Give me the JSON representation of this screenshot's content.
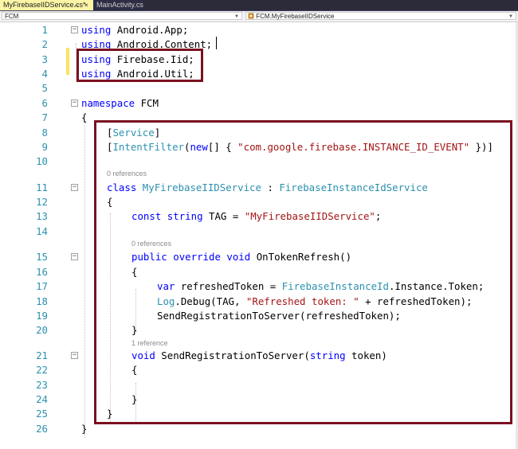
{
  "tabs": [
    {
      "label": "MyFirebaseIIDService.cs*",
      "active": true,
      "pin": "⇔",
      "close": "×"
    },
    {
      "label": "MainActivity.cs",
      "active": false
    }
  ],
  "navbar": {
    "project": "FCM",
    "member": "FCM.MyFirebaseIIDService",
    "dropdown_icon": "dropdown-arrow-icon",
    "class_icon": "class-icon"
  },
  "code_lines": [
    {
      "n": "1",
      "indent": 0,
      "tokens": [
        {
          "t": "using",
          "c": "kw"
        },
        {
          "t": " Android.App;"
        }
      ]
    },
    {
      "n": "2",
      "indent": 0,
      "tokens": [
        {
          "t": "using",
          "c": "kw"
        },
        {
          "t": " Android.Content;"
        }
      ]
    },
    {
      "n": "3",
      "indent": 0,
      "tokens": [
        {
          "t": "using",
          "c": "kw"
        },
        {
          "t": " Firebase.Iid;"
        }
      ]
    },
    {
      "n": "4",
      "indent": 0,
      "tokens": [
        {
          "t": "using",
          "c": "kw"
        },
        {
          "t": " Android.Util;"
        }
      ]
    },
    {
      "n": "5",
      "indent": 0,
      "tokens": []
    },
    {
      "n": "6",
      "indent": 0,
      "tokens": [
        {
          "t": "namespace",
          "c": "kw"
        },
        {
          "t": " FCM"
        }
      ]
    },
    {
      "n": "7",
      "indent": 0,
      "tokens": [
        {
          "t": "{"
        }
      ]
    },
    {
      "n": "8",
      "indent": 1,
      "tokens": [
        {
          "t": "["
        },
        {
          "t": "Service",
          "c": "ty"
        },
        {
          "t": "]"
        }
      ]
    },
    {
      "n": "9",
      "indent": 1,
      "tokens": [
        {
          "t": "["
        },
        {
          "t": "IntentFilter",
          "c": "ty"
        },
        {
          "t": "("
        },
        {
          "t": "new",
          "c": "kw"
        },
        {
          "t": "[] { "
        },
        {
          "t": "\"com.google.firebase.INSTANCE_ID_EVENT\"",
          "c": "st"
        },
        {
          "t": " })]"
        }
      ]
    },
    {
      "n": "10",
      "indent": 0,
      "tokens": []
    },
    {
      "n": "11",
      "indent": 1,
      "refs": "0 references",
      "tokens": [
        {
          "t": "class",
          "c": "kw"
        },
        {
          "t": " "
        },
        {
          "t": "MyFirebaseIIDService",
          "c": "ty"
        },
        {
          "t": " : "
        },
        {
          "t": "FirebaseInstanceIdService",
          "c": "ty"
        }
      ]
    },
    {
      "n": "12",
      "indent": 1,
      "tokens": [
        {
          "t": "{"
        }
      ]
    },
    {
      "n": "13",
      "indent": 2,
      "tokens": [
        {
          "t": "const",
          "c": "kw"
        },
        {
          "t": " "
        },
        {
          "t": "string",
          "c": "kw"
        },
        {
          "t": " TAG = "
        },
        {
          "t": "\"MyFirebaseIIDService\"",
          "c": "st"
        },
        {
          "t": ";"
        }
      ]
    },
    {
      "n": "14",
      "indent": 0,
      "tokens": []
    },
    {
      "n": "15",
      "indent": 2,
      "refs": "0 references",
      "tokens": [
        {
          "t": "public",
          "c": "kw"
        },
        {
          "t": " "
        },
        {
          "t": "override",
          "c": "kw"
        },
        {
          "t": " "
        },
        {
          "t": "void",
          "c": "kw"
        },
        {
          "t": " OnTokenRefresh()"
        }
      ]
    },
    {
      "n": "16",
      "indent": 2,
      "tokens": [
        {
          "t": "{"
        }
      ]
    },
    {
      "n": "17",
      "indent": 3,
      "tokens": [
        {
          "t": "var",
          "c": "kw"
        },
        {
          "t": " refreshedToken = "
        },
        {
          "t": "FirebaseInstanceId",
          "c": "ty"
        },
        {
          "t": ".Instance.Token;"
        }
      ]
    },
    {
      "n": "18",
      "indent": 3,
      "tokens": [
        {
          "t": "Log",
          "c": "ty"
        },
        {
          "t": ".Debug(TAG, "
        },
        {
          "t": "\"Refreshed token: \"",
          "c": "st"
        },
        {
          "t": " + refreshedToken);"
        }
      ]
    },
    {
      "n": "19",
      "indent": 3,
      "tokens": [
        {
          "t": "SendRegistrationToServer(refreshedToken);"
        }
      ]
    },
    {
      "n": "20",
      "indent": 2,
      "tokens": [
        {
          "t": "}"
        }
      ]
    },
    {
      "n": "21",
      "indent": 2,
      "refs": "1 reference",
      "tokens": [
        {
          "t": "void",
          "c": "kw"
        },
        {
          "t": " SendRegistrationToServer("
        },
        {
          "t": "string",
          "c": "kw"
        },
        {
          "t": " token)"
        }
      ]
    },
    {
      "n": "22",
      "indent": 2,
      "tokens": [
        {
          "t": "{"
        }
      ]
    },
    {
      "n": "23",
      "indent": 0,
      "tokens": []
    },
    {
      "n": "24",
      "indent": 2,
      "tokens": [
        {
          "t": "}"
        }
      ]
    },
    {
      "n": "25",
      "indent": 1,
      "tokens": [
        {
          "t": "}"
        }
      ]
    },
    {
      "n": "26",
      "indent": 0,
      "tokens": [
        {
          "t": "}"
        }
      ]
    }
  ],
  "colors": {
    "keyword": "#0000ff",
    "type": "#2b91af",
    "string": "#a31515",
    "line_number": "#2b91af",
    "highlight_box": "#7a1020",
    "change_marker": "#f8e45b"
  }
}
